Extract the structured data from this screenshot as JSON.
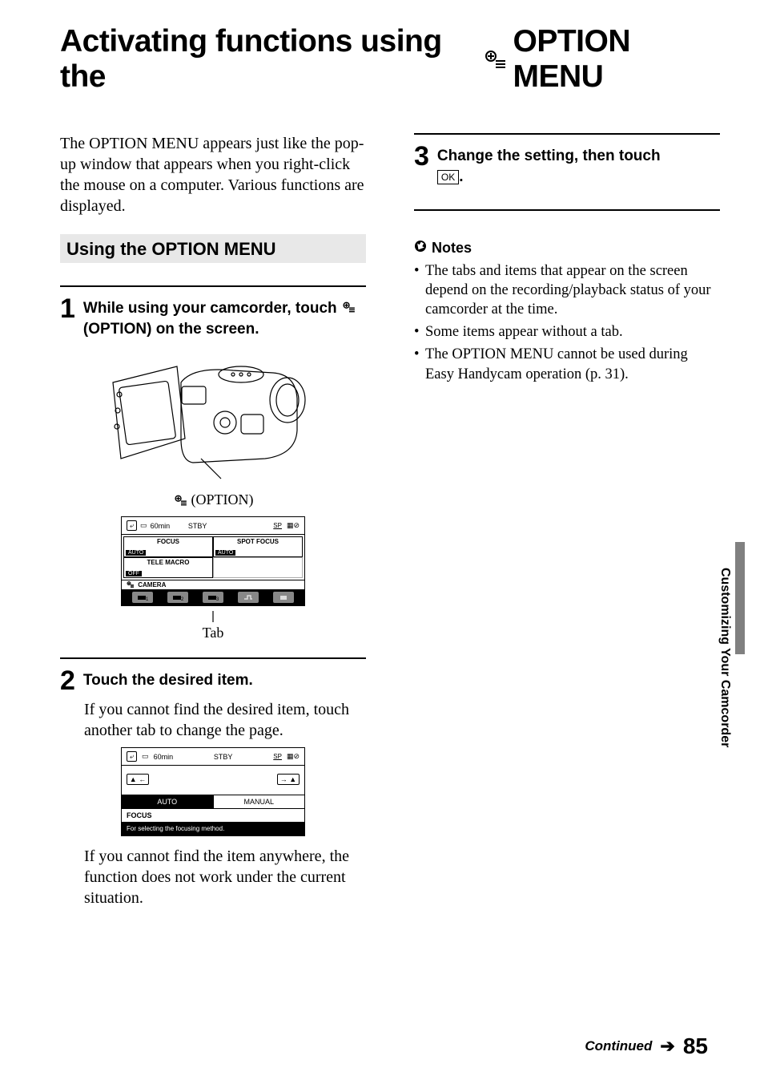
{
  "title": {
    "part1": "Activating functions using the ",
    "part2": "OPTION MENU"
  },
  "intro": "The OPTION MENU appears just like the pop-up window that appears when you right-click the mouse on a computer. Various functions are displayed.",
  "section_header": "Using the OPTION MENU",
  "steps": {
    "s1": {
      "num": "1",
      "text_a": "While using your camcorder, touch ",
      "text_b": "(OPTION) on the screen."
    },
    "s2": {
      "num": "2",
      "text": "Touch the desired item.",
      "body1": "If you cannot find the desired item, touch another tab to change the page.",
      "body2": "If you cannot find the item anywhere, the function does not work under the current situation."
    },
    "s3": {
      "num": "3",
      "text_a": "Change the setting, then touch ",
      "ok": "OK",
      "text_b": "."
    }
  },
  "illus": {
    "caption": "(OPTION)",
    "tab_label": "Tab"
  },
  "lcd1": {
    "time": "60min",
    "status": "STBY",
    "focus": "FOCUS",
    "focus_val": "AUTO",
    "spot": "SPOT FOCUS",
    "spot_val": "AUTO",
    "tele": "TELE MACRO",
    "tele_val": "OFF",
    "camera": "CAMERA"
  },
  "lcd2": {
    "time": "60min",
    "status": "STBY",
    "auto": "AUTO",
    "manual": "MANUAL",
    "focus": "FOCUS",
    "desc": "For selecting the focusing method."
  },
  "notes": {
    "header": "Notes",
    "items": [
      "The tabs and items that appear on the screen depend on the recording/playback status of your camcorder at the time.",
      "Some items appear without a tab.",
      "The OPTION MENU cannot be used during Easy Handycam operation (p. 31)."
    ]
  },
  "side_tab": "Customizing Your Camcorder",
  "footer": {
    "continued": "Continued",
    "page": "85"
  }
}
